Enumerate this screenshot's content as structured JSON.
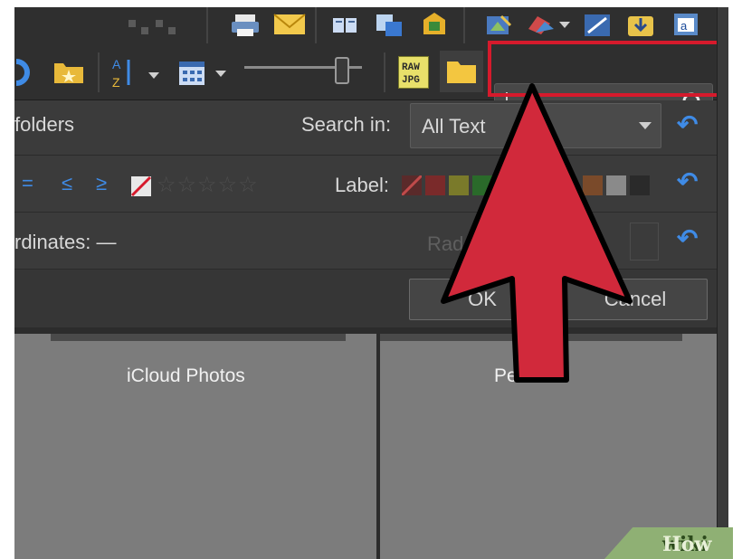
{
  "toolbar": {
    "raw_jpg_label": "RAW\nJPG",
    "sort_letters": "A Z",
    "search": {
      "value": "",
      "placeholder": ""
    }
  },
  "filters": {
    "folders_label": "folders",
    "search_in_label": "Search in:",
    "search_in_value": "All Text",
    "rating_ops": [
      "=",
      "≤",
      "≥"
    ],
    "stars": "☆☆☆☆☆",
    "label_label": "Label:",
    "coordinates_label": "rdinates: —",
    "radius_label": "Rad"
  },
  "buttons": {
    "ok": "OK",
    "cancel": "Cancel"
  },
  "folders": [
    {
      "caption": "iCloud Photos"
    },
    {
      "caption": "Pe"
    }
  ],
  "watermark": {
    "wiki": "wiki",
    "how": "How"
  },
  "colors": {
    "highlight": "#d61a2c",
    "arrow": "#d1293b",
    "accent_blue": "#3f8be6",
    "swatches": [
      "#5a2a2a",
      "#7a2a2a",
      "#7a7a2a",
      "#2a6a2a",
      "#2a3f7a",
      "#5a2a6a",
      "#7a4a2a",
      "#8a8a8a",
      "#2a2a2a"
    ]
  },
  "icons": [
    "print-icon",
    "mail-icon",
    "refresh-icon",
    "favorite-folder-icon",
    "sort-icon",
    "view-grid-icon",
    "raw-jpg-icon",
    "folder-icon",
    "search-icon",
    "reset-icon"
  ]
}
